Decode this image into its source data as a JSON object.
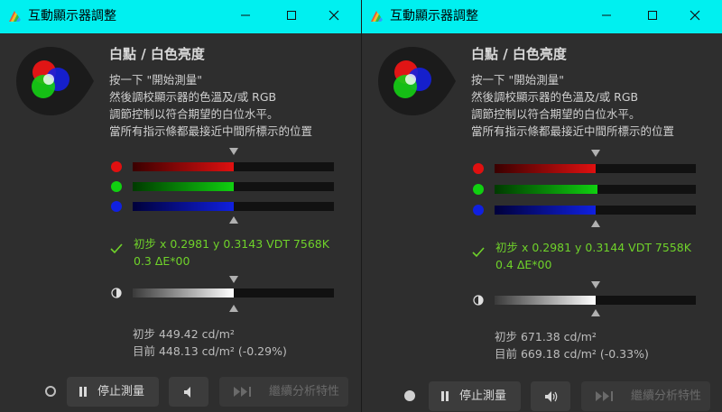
{
  "windows": [
    {
      "title": "互動顯示器調整",
      "heading": "白點 / 白色亮度",
      "instructions": [
        "按一下 \"開始測量\"",
        "然後調校顯示器的色溫及/或 RGB",
        "調節控制以符合期望的白位水平。",
        "當所有指示條都最接近中間所標示的位置"
      ],
      "rgb_bars": [
        {
          "channel": "red",
          "color": "#e01010",
          "level": 0.5
        },
        {
          "channel": "green",
          "color": "#10d010",
          "level": 0.5
        },
        {
          "channel": "blue",
          "color": "#1020e0",
          "level": 0.5
        }
      ],
      "result_line1": "初步 x 0.2981 y 0.3143 VDT 7568K",
      "result_line2": "0.3 ΔE*00",
      "luminance_level": 0.5,
      "initial_luminance": "初步 449.42 cd/m²",
      "current_luminance": "目前 448.13 cd/m² (-0.29%)",
      "stop_label": "停止測量",
      "next_label": "繼續分析特性",
      "sound_icon": "speaker-muted-icon",
      "status_indicator": "hollow"
    },
    {
      "title": "互動顯示器調整",
      "heading": "白點 / 白色亮度",
      "instructions": [
        "按一下 \"開始測量\"",
        "然後調校顯示器的色溫及/或 RGB",
        "調節控制以符合期望的白位水平。",
        "當所有指示條都最接近中間所標示的位置"
      ],
      "rgb_bars": [
        {
          "channel": "red",
          "color": "#e01010",
          "level": 0.5
        },
        {
          "channel": "green",
          "color": "#10d010",
          "level": 0.51
        },
        {
          "channel": "blue",
          "color": "#1020e0",
          "level": 0.5
        }
      ],
      "result_line1": "初步 x 0.2981 y 0.3144 VDT 7558K",
      "result_line2": "0.4 ΔE*00",
      "luminance_level": 0.5,
      "initial_luminance": "初步 671.38 cd/m²",
      "current_luminance": "目前 669.18 cd/m² (-0.33%)",
      "stop_label": "停止測量",
      "next_label": "繼續分析特性",
      "sound_icon": "speaker-on-icon",
      "status_indicator": "filled"
    }
  ],
  "colors": {
    "titlebar": "#00f0f0",
    "background": "#2e2e2e",
    "result_text": "#6fd22a"
  }
}
